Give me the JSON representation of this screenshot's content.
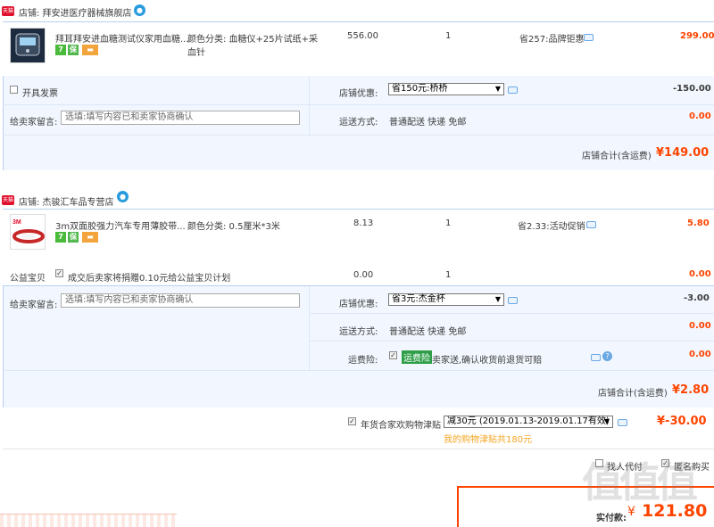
{
  "shop1": {
    "badge": "天猫",
    "name": "店铺: 拜安进医疗器械旗舰店",
    "item": {
      "title": "拜耳拜安进血糖测试仪家用血糖...",
      "sku_line1": "颜色分类: 血糖仪+25片试纸+采",
      "sku_line2": "血针",
      "price": "556.00",
      "qty": "1",
      "discount": "省257:品牌钜惠",
      "subtotal": "299.00"
    },
    "invoice_label": "开具发票",
    "promo_label": "店铺优惠:",
    "promo_select": "省150元:桥桥",
    "promo_amount": "-150.00",
    "message_label": "给卖家留言:",
    "message_placeholder": "选填:填写内容已和卖家协商确认",
    "shipping_label": "运送方式:",
    "shipping_value": "普通配送 快递 免邮",
    "shipping_amount": "0.00",
    "total_label": "店铺合计(含运费)",
    "total_value": "¥149.00"
  },
  "shop2": {
    "badge": "天猫",
    "name": "店铺: 杰骏汇车品专营店",
    "item": {
      "title": "3m双面胶强力汽车专用薄胶带...",
      "sku": "颜色分类: 0.5厘米*3米",
      "price": "8.13",
      "qty": "1",
      "discount": "省2.33:活动促销",
      "subtotal": "5.80"
    },
    "charity_label": "公益宝贝",
    "charity_text": "成交后卖家将捐赠0.10元给公益宝贝计划",
    "charity_price": "0.00",
    "charity_qty": "1",
    "charity_amount": "0.00",
    "message_label": "给卖家留言:",
    "message_placeholder": "选填:填写内容已和卖家协商确认",
    "promo_label": "店铺优惠:",
    "promo_select": "省3元:杰金杯",
    "promo_amount": "-3.00",
    "shipping_label": "运送方式:",
    "shipping_value": "普通配送 快递 免邮",
    "shipping_amount": "0.00",
    "insurance_label": "运费险:",
    "insurance_tag": "运费险",
    "insurance_text": "卖家送,确认收货前退货可赔",
    "insurance_amount": "0.00",
    "total_label": "店铺合计(含运费)",
    "total_value": "¥2.80"
  },
  "coupon": {
    "label": "年货合家欢购物津贴",
    "select": "减30元 (2019.01.13-2019.01.17有效)",
    "amount": "¥-30.00",
    "note": "我的购物津贴共180元"
  },
  "options": {
    "proxy": "找人代付",
    "anonymous": "匿名购买"
  },
  "payment": {
    "label": "实付款:",
    "currency": "¥",
    "amount": "121.80"
  },
  "watermark": "值值值"
}
